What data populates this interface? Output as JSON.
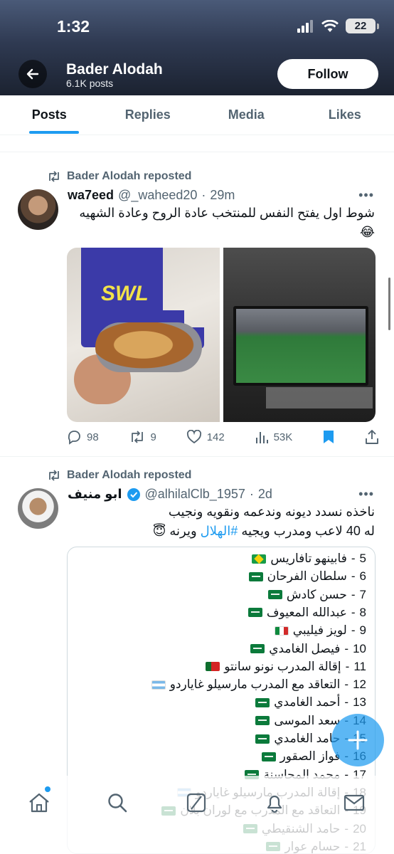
{
  "status_bar": {
    "time": "1:32",
    "battery": "22"
  },
  "profile": {
    "name": "Bader Alodah",
    "posts_count": "6.1K posts",
    "follow_label": "Follow"
  },
  "tabs": [
    {
      "label": "Posts",
      "active": true
    },
    {
      "label": "Replies",
      "active": false
    },
    {
      "label": "Media",
      "active": false
    },
    {
      "label": "Likes",
      "active": false
    }
  ],
  "posts": [
    {
      "repost_label": "Bader Alodah reposted",
      "author": "wa7eed",
      "handle": "@_waheed20",
      "time": "29m",
      "text_line1": "شوط اول يفتح النفس للمنتخب عادة الروح وعادة الشهيه",
      "text_line2": "😂",
      "image_left_logo": "SWL",
      "stats": {
        "replies": "98",
        "reposts": "9",
        "likes": "142",
        "views": "53K"
      }
    },
    {
      "repost_label": "Bader Alodah reposted",
      "author": "ابو منيف",
      "handle": "@alhilalClb_1957",
      "time": "2d",
      "text_line1": "ناخذه نسدد ديونه وندعمه ونقويه ونجيب",
      "text_line2_pre": "له 40 لاعب ومدرب ويجيه",
      "hashtag": "#الهلال",
      "text_line2_post": "ويرنه 😇",
      "list_items": [
        {
          "num": "5",
          "text": "فابينهو تافاريس",
          "flag": "br"
        },
        {
          "num": "6",
          "text": "سلطان الفرحان",
          "flag": "sa"
        },
        {
          "num": "7",
          "text": "حسن كادش",
          "flag": "sa"
        },
        {
          "num": "8",
          "text": "عبدالله المعيوف",
          "flag": "sa"
        },
        {
          "num": "9",
          "text": "لويز فيليبي",
          "flag": "it"
        },
        {
          "num": "10",
          "text": "فيصل الغامدي",
          "flag": "sa"
        },
        {
          "num": "11",
          "text": "إقالة المدرب نونو سانتو",
          "flag": "pt"
        },
        {
          "num": "12",
          "text": "التعاقد مع المدرب مارسيلو غاياردو",
          "flag": "ar"
        },
        {
          "num": "13",
          "text": "أحمد الغامدي",
          "flag": "sa"
        },
        {
          "num": "14",
          "text": "سعد الموسى",
          "flag": "sa"
        },
        {
          "num": "15",
          "text": "حامد الغامدي",
          "flag": "sa"
        },
        {
          "num": "16",
          "text": "فواز الصقور",
          "flag": "sa"
        },
        {
          "num": "17",
          "text": "محمد المحاسنة",
          "flag": "sa"
        },
        {
          "num": "18",
          "text": "إقالة المدرب مارسيلو غاياردو",
          "flag": "ar"
        },
        {
          "num": "19",
          "text": "التعاقد مع المدرب مع لوران بلان",
          "flag": "sa"
        },
        {
          "num": "20",
          "text": "حامد الشنقيطي",
          "flag": "sa"
        },
        {
          "num": "21",
          "text": "حسام عوار",
          "flag": "sa"
        }
      ]
    }
  ],
  "icons": {
    "back": "arrow-left-icon",
    "more": "more-icon",
    "reply": "reply-icon",
    "repost": "repost-icon",
    "like": "heart-icon",
    "views": "views-icon",
    "bookmark": "bookmark-icon",
    "share": "share-icon",
    "compose": "plus-icon",
    "home": "home-icon",
    "search": "search-icon",
    "grok": "grok-icon",
    "notifications": "bell-icon",
    "messages": "mail-icon"
  },
  "colors": {
    "accent": "#1d9bf0",
    "text": "#0f1419",
    "muted": "#536471",
    "verified": "#1d9bf0"
  }
}
